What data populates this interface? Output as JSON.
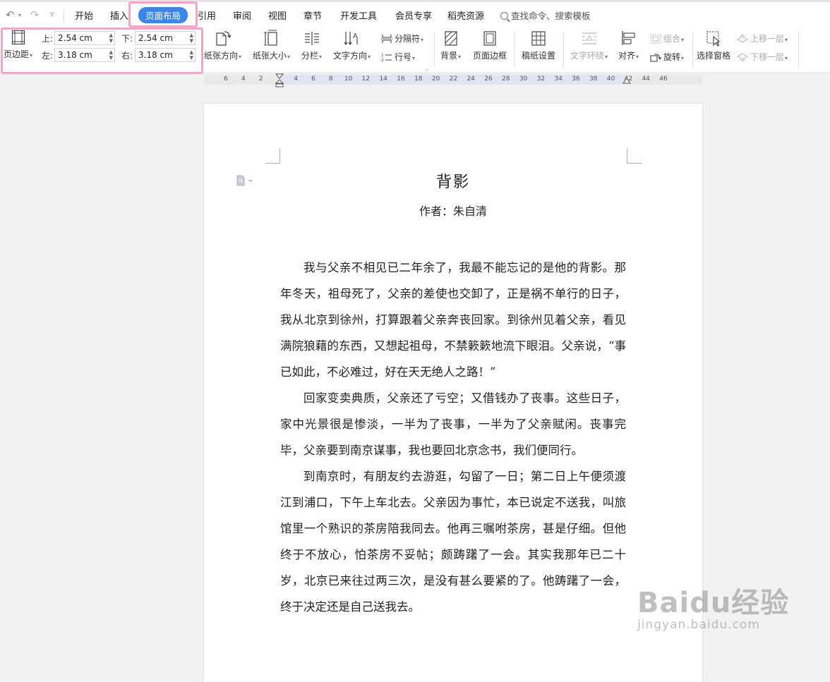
{
  "quick_access": {
    "undo": "↶",
    "redo": "↷",
    "customize": "▿"
  },
  "menu": {
    "tabs": [
      "开始",
      "插入",
      "页面布局",
      "引用",
      "审阅",
      "视图",
      "章节",
      "开发工具",
      "会员专享",
      "稻壳资源"
    ],
    "active": "页面布局",
    "search": "查找命令、搜索模板"
  },
  "ribbon": {
    "margins_label": "页边距",
    "top_label": "上:",
    "top_value": "2.54 cm",
    "bottom_label": "下:",
    "bottom_value": "2.54 cm",
    "left_label": "左:",
    "left_value": "3.18 cm",
    "right_label": "右:",
    "right_value": "3.18 cm",
    "orientation": "纸张方向",
    "size": "纸张大小",
    "columns": "分栏",
    "text_direction": "文字方向",
    "breaks": "分隔符",
    "line_numbers": "行号",
    "background": "背景",
    "page_border": "页面边框",
    "manuscript": "稿纸设置",
    "text_wrap": "文字环绕",
    "align": "对齐",
    "group": "组合",
    "rotate": "旋转",
    "selection_pane": "选择窗格",
    "bring_forward": "上移一层",
    "send_backward": "下移一层"
  },
  "ruler": {
    "labels": [
      "6",
      "4",
      "2",
      "2",
      "4",
      "6",
      "8",
      "10",
      "12",
      "14",
      "16",
      "18",
      "20",
      "22",
      "24",
      "26",
      "28",
      "30",
      "32",
      "34",
      "36",
      "38",
      "40",
      "42",
      "44",
      "46"
    ]
  },
  "document": {
    "title": "背影",
    "author": "作者：朱自清",
    "paragraphs": [
      "我与父亲不相见已二年余了，我最不能忘记的是他的背影。那年冬天，祖母死了，父亲的差使也交卸了，正是祸不单行的日子，我从北京到徐州，打算跟着父亲奔丧回家。到徐州见着父亲，看见满院狼藉的东西，又想起祖母，不禁簌簌地流下眼泪。父亲说，“事已如此，不必难过，好在天无绝人之路！”",
      "回家变卖典质，父亲还了亏空；又借钱办了丧事。这些日子，家中光景很是惨淡，一半为了丧事，一半为了父亲赋闲。丧事完毕，父亲要到南京谋事，我也要回北京念书，我们便同行。",
      "到南京时，有朋友约去游逛，勾留了一日；第二日上午便须渡江到浦口，下午上车北去。父亲因为事忙，本已说定不送我，叫旅馆里一个熟识的茶房陪我同去。他再三嘱咐茶房，甚是仔细。但他终于不放心，怕茶房不妥帖；颇踌躇了一会。其实我那年已二十岁，北京已来往过两三次，是没有甚么要紧的了。他踌躇了一会，终于决定还是自己送我去。"
    ]
  },
  "watermark": {
    "brand": "Baidu经验",
    "url": "jingyan.baidu.com"
  },
  "colors": {
    "accent": "#3b86ea",
    "highlight": "#f4a6c8"
  }
}
